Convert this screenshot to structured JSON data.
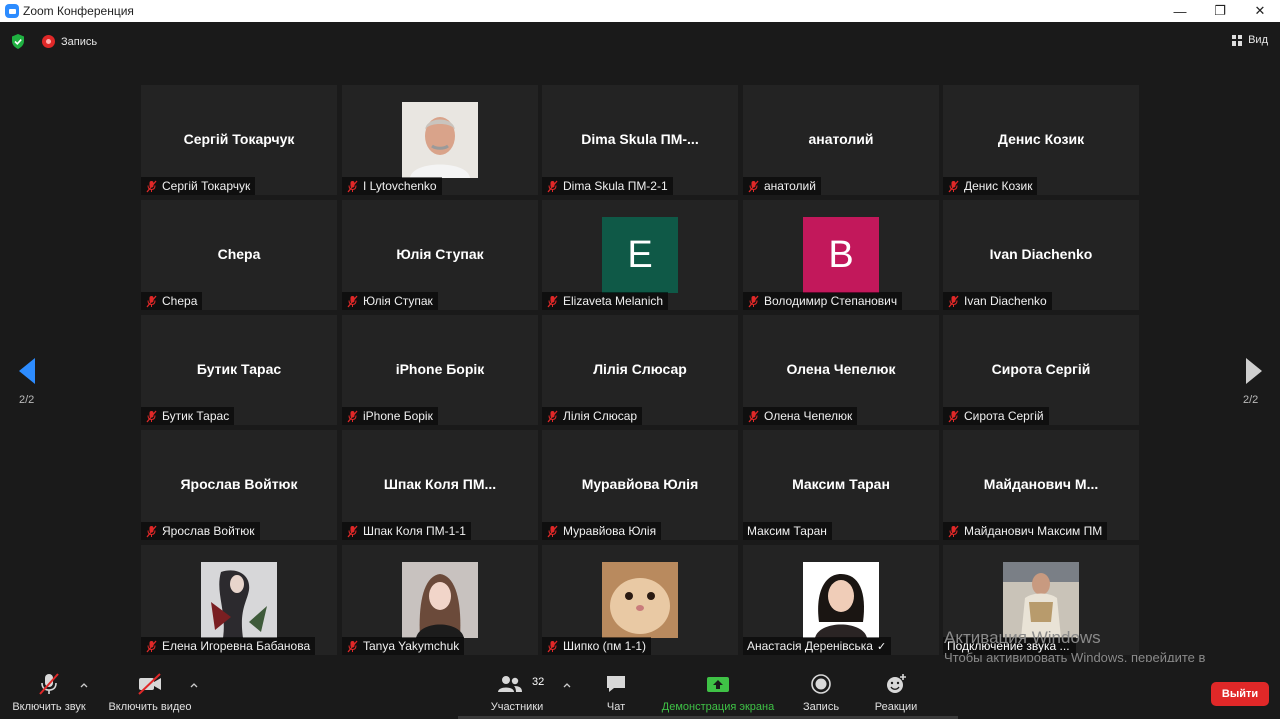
{
  "window": {
    "title": "Zoom Конференция",
    "min_glyph": "—",
    "max_glyph": "❐",
    "close_glyph": "✕"
  },
  "topbar": {
    "recording_label": "Запись",
    "view_label": "Вид"
  },
  "gallery": {
    "page_indicator_left": "2/2",
    "page_indicator_right": "2/2",
    "tiles": [
      {
        "display": "Сергій Токарчук",
        "label": "Сергій Токарчук",
        "muted": true,
        "kind": "name"
      },
      {
        "display": "",
        "label": "I Lytovchenko",
        "muted": true,
        "kind": "photo-man"
      },
      {
        "display": "Dima Skula ПМ-...",
        "label": "Dima Skula ПМ-2-1",
        "muted": true,
        "kind": "name"
      },
      {
        "display": "анатолий",
        "label": "анатолий",
        "muted": true,
        "kind": "name"
      },
      {
        "display": "Денис Козик",
        "label": "Денис Козик",
        "muted": true,
        "kind": "name"
      },
      {
        "display": "Chepa",
        "label": "Chepa",
        "muted": true,
        "kind": "name"
      },
      {
        "display": "Юлія Ступак",
        "label": "Юлія Ступак",
        "muted": true,
        "kind": "name"
      },
      {
        "display": "E",
        "label": "Elizaveta Melanich",
        "muted": true,
        "kind": "letter",
        "color": "#0f5947"
      },
      {
        "display": "B",
        "label": "Володимир Степанович",
        "muted": true,
        "kind": "letter",
        "color": "#c2185b"
      },
      {
        "display": "Ivan Diachenko",
        "label": "Ivan Diachenko",
        "muted": true,
        "kind": "name"
      },
      {
        "display": "Бутик Тарас",
        "label": "Бутик Тарас",
        "muted": true,
        "kind": "name"
      },
      {
        "display": "iPhone Борік",
        "label": "iPhone Борік",
        "muted": true,
        "kind": "name"
      },
      {
        "display": "Лілія Слюсар",
        "label": "Лілія Слюсар",
        "muted": true,
        "kind": "name"
      },
      {
        "display": "Олена Чепелюк",
        "label": "Олена Чепелюк",
        "muted": true,
        "kind": "name"
      },
      {
        "display": "Сирота Сергій",
        "label": "Сирота Сергій",
        "muted": true,
        "kind": "name"
      },
      {
        "display": "Ярослав Войтюк",
        "label": "Ярослав Войтюк",
        "muted": true,
        "kind": "name"
      },
      {
        "display": "Шпак Коля ПМ...",
        "label": "Шпак Коля ПМ-1-1",
        "muted": true,
        "kind": "name"
      },
      {
        "display": "Муравйова Юлія",
        "label": "Муравйова Юлія",
        "muted": true,
        "kind": "name"
      },
      {
        "display": "Максим Таран",
        "label": "Максим Таран",
        "muted": false,
        "kind": "name"
      },
      {
        "display": "Майданович М...",
        "label": "Майданович Максим ПМ",
        "muted": true,
        "kind": "name"
      },
      {
        "display": "",
        "label": "Елена Игоревна Бабанова",
        "muted": true,
        "kind": "photo-art"
      },
      {
        "display": "",
        "label": "Tanya Yakymchuk",
        "muted": true,
        "kind": "photo-girl"
      },
      {
        "display": "",
        "label": "Шипко (пм 1-1)",
        "muted": true,
        "kind": "photo-hamster"
      },
      {
        "display": "",
        "label": "Анастасія Деренівська",
        "muted": false,
        "kind": "photo-woman",
        "check": "✓"
      },
      {
        "display": "",
        "label": "Подключение звука ...",
        "muted": false,
        "kind": "photo-person",
        "connecting": true
      }
    ]
  },
  "watermark": {
    "title": "Активация Windows",
    "text": "Чтобы активировать Windows, перейдите в раздел \"Параметры\"."
  },
  "toolbar": {
    "audio_label": "Включить звук",
    "video_label": "Включить видео",
    "participants_label": "Участники",
    "participants_count": "32",
    "chat_label": "Чат",
    "share_label": "Демонстрация экрана",
    "record_label": "Запись",
    "reactions_label": "Реакции",
    "leave_label": "Выйти",
    "share_color": "#3fc246"
  }
}
